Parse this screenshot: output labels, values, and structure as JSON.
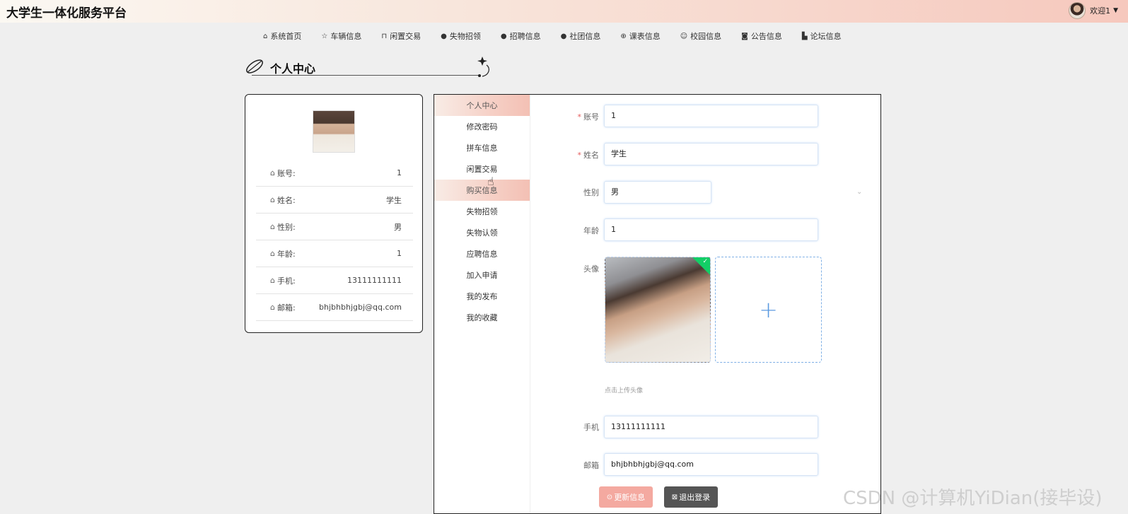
{
  "header": {
    "site_title": "大学生一体化服务平台",
    "welcome": "欢迎1"
  },
  "nav": {
    "items": [
      {
        "label": "系统首页",
        "icon": "home-icon"
      },
      {
        "label": "车辆信息",
        "icon": "star-icon"
      },
      {
        "label": "闲置交易",
        "icon": "bag-icon"
      },
      {
        "label": "失物招领",
        "icon": "info-icon"
      },
      {
        "label": "招聘信息",
        "icon": "question-icon"
      },
      {
        "label": "社团信息",
        "icon": "info-icon"
      },
      {
        "label": "课表信息",
        "icon": "globe-icon"
      },
      {
        "label": "校园信息",
        "icon": "smile-icon"
      },
      {
        "label": "公告信息",
        "icon": "camera-icon"
      },
      {
        "label": "论坛信息",
        "icon": "cake-icon"
      }
    ]
  },
  "section": {
    "title": "个人中心"
  },
  "profile": {
    "rows": [
      {
        "label": "账号:",
        "value": "1"
      },
      {
        "label": "姓名:",
        "value": "学生"
      },
      {
        "label": "性别:",
        "value": "男"
      },
      {
        "label": "年龄:",
        "value": "1"
      },
      {
        "label": "手机:",
        "value": "13111111111"
      },
      {
        "label": "邮箱:",
        "value": "bhjbhbhjgbj@qq.com"
      }
    ]
  },
  "menu": {
    "items": [
      "个人中心",
      "修改密码",
      "拼车信息",
      "闲置交易",
      "购买信息",
      "失物招领",
      "失物认领",
      "应聘信息",
      "加入申请",
      "我的发布",
      "我的收藏"
    ],
    "active": [
      0,
      4
    ]
  },
  "form": {
    "account_label": "账号",
    "account_value": "1",
    "name_label": "姓名",
    "name_value": "学生",
    "gender_label": "性别",
    "gender_value": "男",
    "age_label": "年龄",
    "age_value": "1",
    "avatar_label": "头像",
    "upload_hint": "点击上传头像",
    "phone_label": "手机",
    "phone_value": "13111111111",
    "email_label": "邮箱",
    "email_value": "bhjbhbhjgbj@qq.com",
    "update_button": "更新信息",
    "logout_button": "退出登录"
  },
  "watermark": "CSDN @计算机YiDian(接毕设)",
  "colors": {
    "active_menu": "#f6d0c6",
    "update_button": "#f4a9a0",
    "logout_button": "#555555",
    "required_star": "#e45a5a"
  }
}
